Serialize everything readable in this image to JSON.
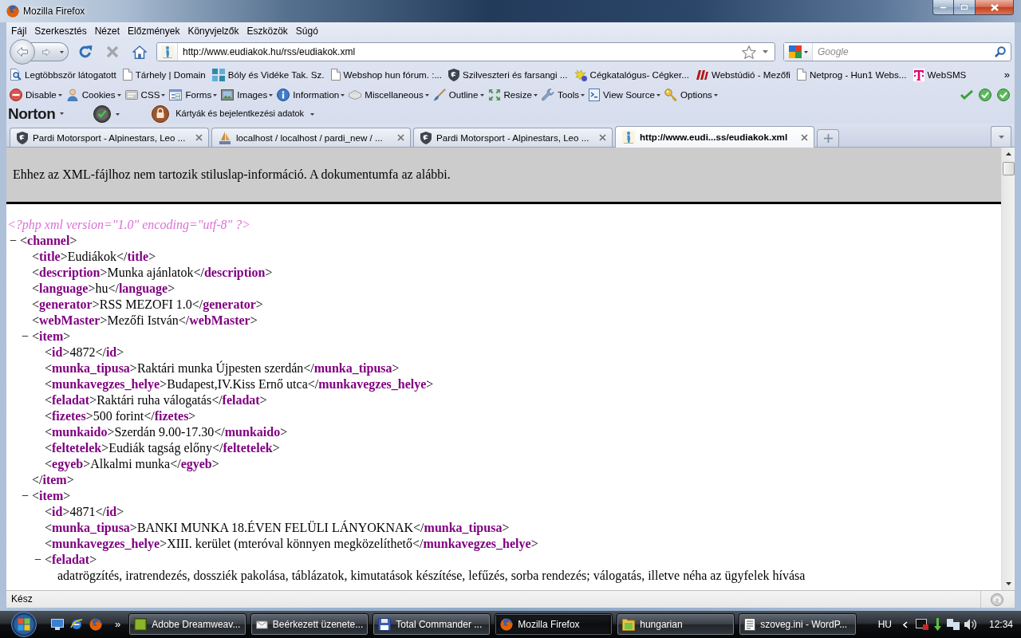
{
  "window": {
    "title": "Mozilla Firefox"
  },
  "menu": [
    "Fájl",
    "Szerkesztés",
    "Nézet",
    "Előzmények",
    "Könyvjelzők",
    "Eszközök",
    "Súgó"
  ],
  "navigation": {
    "url": "http://www.eudiakok.hu/rss/eudiakok.xml",
    "search_placeholder": "Google"
  },
  "bookmarks": {
    "items": [
      {
        "label": "Legtöbbször látogatott",
        "kind": "query"
      },
      {
        "label": "Tárhely | Domain",
        "kind": "page"
      },
      {
        "label": "Bóly és Vidéke Tak. Sz.",
        "kind": "tiles"
      },
      {
        "label": "Webshop hun fórum. :...",
        "kind": "page"
      },
      {
        "label": "Szilveszteri és farsangi ...",
        "kind": "shield"
      },
      {
        "label": "Cégkatalógus- Cégker...",
        "kind": "sprite"
      },
      {
        "label": "Webstúdió - Mezőfi",
        "kind": "brand"
      },
      {
        "label": "Netprog - Hun1 Webs...",
        "kind": "page"
      },
      {
        "label": "WebSMS",
        "kind": "letter"
      }
    ],
    "overflow": "»"
  },
  "developer_toolbar": [
    {
      "label": "Disable",
      "kind": "disable"
    },
    {
      "label": "Cookies",
      "kind": "cookies"
    },
    {
      "label": "CSS",
      "kind": "css"
    },
    {
      "label": "Forms",
      "kind": "forms"
    },
    {
      "label": "Images",
      "kind": "images"
    },
    {
      "label": "Information",
      "kind": "information"
    },
    {
      "label": "Miscellaneous",
      "kind": "miscellaneous"
    },
    {
      "label": "Outline",
      "kind": "outline"
    },
    {
      "label": "Resize",
      "kind": "resize"
    },
    {
      "label": "Tools",
      "kind": "tools"
    },
    {
      "label": "View Source",
      "kind": "source"
    },
    {
      "label": "Options",
      "kind": "options"
    }
  ],
  "norton_toolbar": {
    "logo": "Norton",
    "identity_label": "Kártyák és bejelentkezési adatok"
  },
  "tabs": [
    {
      "title": "Pardi Motorsport - Alpinestars, Leo ...",
      "kind": "shield",
      "selected": false
    },
    {
      "title": "localhost / localhost / pardi_new / ...",
      "kind": "pma",
      "selected": false
    },
    {
      "title": "Pardi Motorsport - Alpinestars, Leo ...",
      "kind": "shield",
      "selected": false
    },
    {
      "title": "http://www.eudi...ss/eudiakok.xml",
      "kind": "site",
      "selected": true
    }
  ],
  "document": {
    "notice": "Ehhez az XML-fájlhoz nem tartozik stiluslap-információ. A dokumentumfa az alábbi.",
    "prolog": "<?php xml version=\"1.0\" encoding=\"utf-8\" ?>",
    "tree": [
      {
        "toggle": "−",
        "open": [
          "<",
          "channel",
          ">"
        ],
        "children": [
          {
            "open": [
              "<",
              "title",
              ">"
            ],
            "text": "Eudiákok",
            "close": [
              "</",
              "title",
              ">"
            ]
          },
          {
            "open": [
              "<",
              "description",
              ">"
            ],
            "text": "Munka ajánlatok",
            "close": [
              "</",
              "description",
              ">"
            ]
          },
          {
            "open": [
              "<",
              "language",
              ">"
            ],
            "text": "hu",
            "close": [
              "</",
              "language",
              ">"
            ]
          },
          {
            "open": [
              "<",
              "generator",
              ">"
            ],
            "text": "RSS MEZOFI 1.0",
            "close": [
              "</",
              "generator",
              ">"
            ]
          },
          {
            "open": [
              "<",
              "webMaster",
              ">"
            ],
            "text": "Mezőfi István",
            "close": [
              "</",
              "webMaster",
              ">"
            ]
          },
          {
            "toggle": "−",
            "open": [
              "<",
              "item",
              ">"
            ],
            "children": [
              {
                "open": [
                  "<",
                  "id",
                  ">"
                ],
                "text": "4872",
                "close": [
                  "</",
                  "id",
                  ">"
                ]
              },
              {
                "open": [
                  "<",
                  "munka_tipusa",
                  ">"
                ],
                "text": "Raktári munka Újpesten szerdán",
                "close": [
                  "</",
                  "munka_tipusa",
                  ">"
                ]
              },
              {
                "open": [
                  "<",
                  "munkavegzes_helye",
                  ">"
                ],
                "text": "Budapest,IV.Kiss Ernő utca",
                "close": [
                  "</",
                  "munkavegzes_helye",
                  ">"
                ]
              },
              {
                "open": [
                  "<",
                  "feladat",
                  ">"
                ],
                "text": "Raktári ruha válogatás",
                "close": [
                  "</",
                  "feladat",
                  ">"
                ]
              },
              {
                "open": [
                  "<",
                  "fizetes",
                  ">"
                ],
                "text": "500 forint",
                "close": [
                  "</",
                  "fizetes",
                  ">"
                ]
              },
              {
                "open": [
                  "<",
                  "munkaido",
                  ">"
                ],
                "text": "Szerdán 9.00-17.30",
                "close": [
                  "</",
                  "munkaido",
                  ">"
                ]
              },
              {
                "open": [
                  "<",
                  "feltetelek",
                  ">"
                ],
                "text": "Eudiák tagság előny",
                "close": [
                  "</",
                  "feltetelek",
                  ">"
                ]
              },
              {
                "open": [
                  "<",
                  "egyeb",
                  ">"
                ],
                "text": "Alkalmi munka",
                "close": [
                  "</",
                  "egyeb",
                  ">"
                ]
              }
            ],
            "close": [
              "</",
              "item",
              ">"
            ]
          },
          {
            "toggle": "−",
            "open": [
              "<",
              "item",
              ">"
            ],
            "children": [
              {
                "open": [
                  "<",
                  "id",
                  ">"
                ],
                "text": "4871",
                "close": [
                  "</",
                  "id",
                  ">"
                ]
              },
              {
                "open": [
                  "<",
                  "munka_tipusa",
                  ">"
                ],
                "text": "BANKI MUNKA 18.ÉVEN FELÜLI LÁNYOKNAK",
                "close": [
                  "</",
                  "munka_tipusa",
                  ">"
                ]
              },
              {
                "open": [
                  "<",
                  "munkavegzes_helye",
                  ">"
                ],
                "text": "XIII. kerület (mteróval könnyen megközelíthető",
                "close": [
                  "</",
                  "munkavegzes_helye",
                  ">"
                ]
              },
              {
                "toggle": "−",
                "open": [
                  "<",
                  "feladat",
                  ">"
                ],
                "children": [
                  {
                    "text": "adatrögzítés, iratrendezés, dossziék pakolása, táblázatok, kimutatások készítése, lefűzés, sorba rendezés; válogatás, illetve néha az ügyfelek hívása"
                  }
                ]
              }
            ]
          }
        ]
      }
    ]
  },
  "status_bar": {
    "text": "Kész"
  },
  "taskbar": {
    "overflow": "»",
    "tasks": [
      {
        "label": "Adobe Dreamweav...",
        "kind": "dreamweaver",
        "selected": false
      },
      {
        "label": "Beérkezett üzenete...",
        "kind": "mail",
        "selected": false
      },
      {
        "label": "Total Commander ...",
        "kind": "floppy",
        "selected": false
      },
      {
        "label": "Mozilla Firefox",
        "kind": "firefox",
        "selected": true
      },
      {
        "label": "hungarian",
        "kind": "folder",
        "selected": false
      },
      {
        "label": "szoveg.ini - WordP...",
        "kind": "notepad",
        "selected": false
      }
    ],
    "language": "HU",
    "clock": "12:34"
  }
}
